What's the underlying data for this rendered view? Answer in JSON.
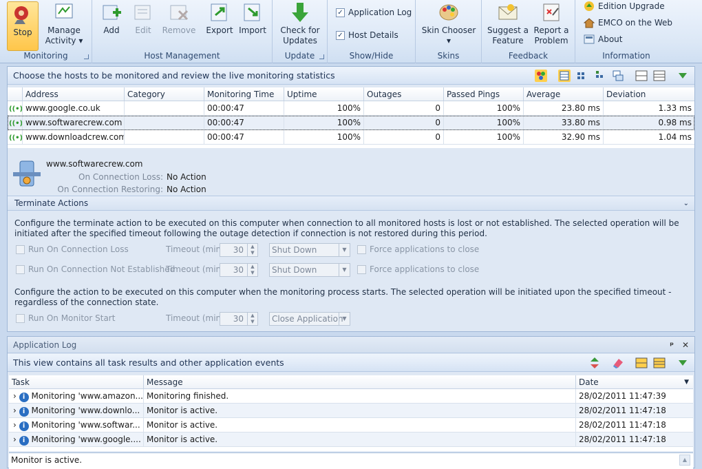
{
  "ribbon": {
    "monitoring": {
      "label": "Monitoring",
      "stop": "Stop",
      "manage": "Manage",
      "manage2": "Activity ▾"
    },
    "host_management": {
      "label": "Host Management",
      "add": "Add",
      "edit": "Edit",
      "remove": "Remove",
      "export": "Export",
      "import": "Import"
    },
    "update": {
      "label": "Update",
      "check": "Check for",
      "check2": "Updates"
    },
    "show_hide": {
      "label": "Show/Hide",
      "app_log": "Application Log",
      "host_details": "Host Details"
    },
    "skins": {
      "label": "Skins",
      "chooser": "Skin Chooser",
      "chooser2": "▾"
    },
    "feedback": {
      "label": "Feedback",
      "suggest": "Suggest a",
      "suggest2": "Feature",
      "report": "Report a",
      "report2": "Problem"
    },
    "information": {
      "label": "Information",
      "upgrade": "Edition Upgrade",
      "web": "EMCO on the Web",
      "about": "About"
    }
  },
  "hosts_panel": {
    "caption": "Choose the hosts to be monitored and review the live monitoring statistics",
    "columns": [
      "Address",
      "Category",
      "Monitoring Time",
      "Uptime",
      "Outages",
      "Passed Pings",
      "Average",
      "Deviation"
    ],
    "rows": [
      {
        "address": "www.google.co.uk",
        "category": "",
        "time": "00:00:47",
        "uptime": "100%",
        "outages": "0",
        "passed": "100%",
        "average": "23.80 ms",
        "deviation": "1.33 ms"
      },
      {
        "address": "www.softwarecrew.com",
        "category": "",
        "time": "00:00:47",
        "uptime": "100%",
        "outages": "0",
        "passed": "100%",
        "average": "33.80 ms",
        "deviation": "0.98 ms"
      },
      {
        "address": "www.downloadcrew.com",
        "category": "",
        "time": "00:00:47",
        "uptime": "100%",
        "outages": "0",
        "passed": "100%",
        "average": "32.90 ms",
        "deviation": "1.04 ms"
      }
    ]
  },
  "host_details": {
    "host": "www.softwarecrew.com",
    "loss_label": "On Connection Loss:",
    "loss_value": "No Action",
    "restore_label": "On Connection Restoring:",
    "restore_value": "No Action"
  },
  "terminate": {
    "header": "Terminate Actions",
    "desc1": "Configure the terminate action to be executed on this computer when connection to all monitored hosts is lost or not established. The selected operation will be initiated after the specified timeout following the outage detection if connection is not restored during this period.",
    "run_loss": "Run On Connection Loss",
    "run_not_est": "Run On Connection Not Established",
    "timeout_label": "Timeout (min):",
    "timeout_value": "30",
    "shutdown": "Shut Down",
    "force": "Force applications to close",
    "desc2": "Configure the action to be executed on this computer when the monitoring process starts. The selected operation will be initiated upon the specified timeout - regardless of the connection state.",
    "run_start": "Run On Monitor Start",
    "close_app": "Close Application"
  },
  "app_log": {
    "title": "Application Log",
    "pin": "ᵖ",
    "close": "✕",
    "caption": "This view contains all task results and other application events",
    "columns": [
      "Task",
      "Message",
      "Date"
    ],
    "rows": [
      {
        "task": "Monitoring 'www.amazon...",
        "message": "Monitoring finished.",
        "date": "28/02/2011 11:47:39"
      },
      {
        "task": "Monitoring 'www.downlo...",
        "message": "Monitor is active.",
        "date": "28/02/2011 11:47:18"
      },
      {
        "task": "Monitoring 'www.softwar...",
        "message": "Monitor is active.",
        "date": "28/02/2011 11:47:18"
      },
      {
        "task": "Monitoring 'www.google....",
        "message": "Monitor is active.",
        "date": "28/02/2011 11:47:18"
      }
    ],
    "status": "Monitor is active."
  }
}
